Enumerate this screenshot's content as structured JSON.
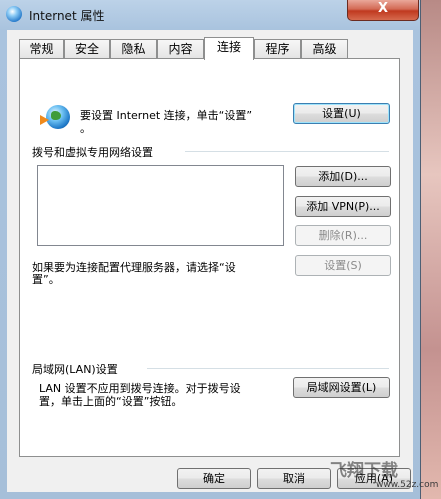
{
  "window": {
    "title": "Internet 属性",
    "close_label": "X"
  },
  "tabs": [
    {
      "label": "常规"
    },
    {
      "label": "安全"
    },
    {
      "label": "隐私"
    },
    {
      "label": "内容"
    },
    {
      "label": "连接",
      "active": true
    },
    {
      "label": "程序"
    },
    {
      "label": "高级"
    }
  ],
  "connection": {
    "setup_text": "要设置 Internet 连接，单击“设置”",
    "setup_text_cont": "。",
    "setup_button": "设置(U)",
    "dialup_section_title": "拨号和虚拟专用网络设置",
    "add_button": "添加(D)...",
    "add_vpn_button": "添加 VPN(P)...",
    "delete_button": "删除(R)...",
    "proxy_text": "如果要为连接配置代理服务器，请选择“设",
    "proxy_text_cont": "置”。",
    "proxy_settings_button": "设置(S)",
    "lan_section_title": "局域网(LAN)设置",
    "lan_text_line1": "LAN 设置不应用到拨号连接。对于拨号设",
    "lan_text_line2": "置，单击上面的“设置”按钮。",
    "lan_settings_button": "局域网设置(L)"
  },
  "footer": {
    "ok_button": "确定",
    "cancel_button": "取消",
    "apply_button": "应用(A)"
  },
  "watermark": {
    "text": "飞翔下载",
    "url": "www.52z.com"
  }
}
